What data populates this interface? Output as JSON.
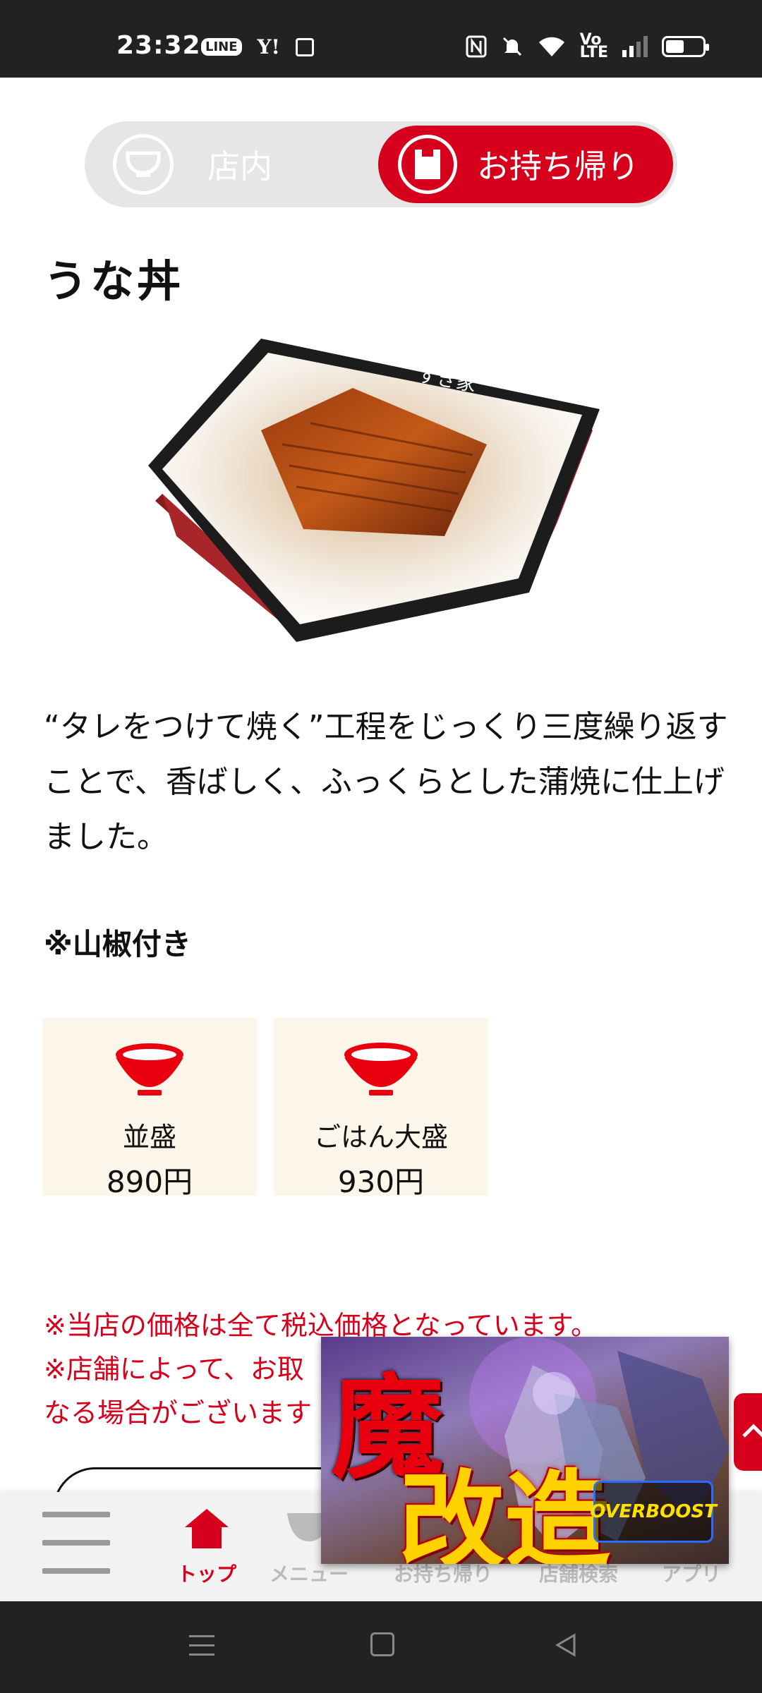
{
  "status_bar": {
    "time": "23:32",
    "app_icons": [
      "line-icon",
      "yahoo-icon",
      "amazon-icon"
    ],
    "line_label": "LINE",
    "yahoo_label": "Y!",
    "sys_icons": [
      "nfc-icon",
      "mute-icon",
      "wifi-icon",
      "volte-icon",
      "signal-icon",
      "battery-icon"
    ],
    "volte_label": "Vo\nLTE",
    "battery_level": 0.5
  },
  "toggle": {
    "eat_in_label": "店内",
    "takeout_label": "お持ち帰り",
    "selected": "takeout"
  },
  "product": {
    "title": "うな丼",
    "description": "“タレをつけて焼く”工程をじっくり三度繰り返すことで、香ばしく、ふっくらとした蒲焼に仕上げました。",
    "note": "※山椒付き",
    "sizes": [
      {
        "name": "並盛",
        "price": "890円"
      },
      {
        "name": "ごはん大盛",
        "price": "930円"
      }
    ]
  },
  "notice": {
    "line1": "※当店の価格は全て税込価格となっています。",
    "line2": "※店舗によって、お取",
    "line3": "なる場合がございます"
  },
  "bottom_nav": {
    "items": [
      {
        "label": "トップ",
        "icon": "home-icon",
        "active": true
      },
      {
        "label": "メニュー",
        "icon": "bowl-icon",
        "active": false
      },
      {
        "label": "お持ち帰り",
        "icon": "bag-icon",
        "active": false
      },
      {
        "label": "店舗検索",
        "icon": "search-icon",
        "active": false
      },
      {
        "label": "アプリ",
        "icon": "app-icon",
        "active": false
      }
    ]
  },
  "ad": {
    "text_top": "魔",
    "text_bottom": "改造",
    "logo_text": "OVERBOOST"
  },
  "colors": {
    "brand_red": "#d6001c",
    "card_bg": "#fcf5ea",
    "toggle_bg": "#e6e6e6"
  }
}
